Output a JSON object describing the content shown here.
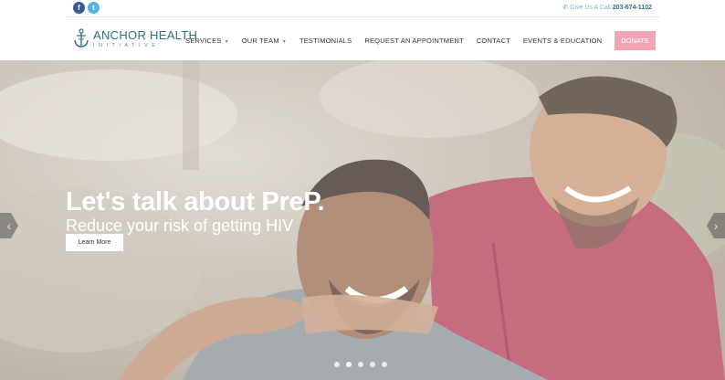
{
  "topbar": {
    "social": [
      {
        "icon": "facebook-icon",
        "glyph": "f"
      },
      {
        "icon": "twitter-icon",
        "glyph": "t"
      }
    ],
    "call_label": "Give Us A Call",
    "phone": "203-674-1102",
    "phone_icon": "phone-icon"
  },
  "logo": {
    "name": "ANCHOR HEALTH",
    "sub": "INITIATIVE",
    "icon": "anchor-logo-icon"
  },
  "nav": {
    "items": [
      {
        "label": "SERVICES",
        "dropdown": true
      },
      {
        "label": "OUR TEAM",
        "dropdown": true
      },
      {
        "label": "TESTIMONIALS",
        "dropdown": false
      },
      {
        "label": "REQUEST AN APPOINTMENT",
        "dropdown": false
      },
      {
        "label": "CONTACT",
        "dropdown": false
      },
      {
        "label": "EVENTS & EDUCATION",
        "dropdown": false
      }
    ],
    "donate": "DONATE",
    "caret_glyph": "▼"
  },
  "hero": {
    "title": "Let's talk about PreP.",
    "subtitle": "Reduce your risk of getting HIV",
    "button": "Learn More",
    "prev_glyph": "‹",
    "next_glyph": "›",
    "slide_count": 5,
    "active_slide": 2
  },
  "colors": {
    "accent": "#2f6f86",
    "donate": "#f4a5b3",
    "facebook": "#3b5998",
    "twitter": "#4fb3e8"
  }
}
